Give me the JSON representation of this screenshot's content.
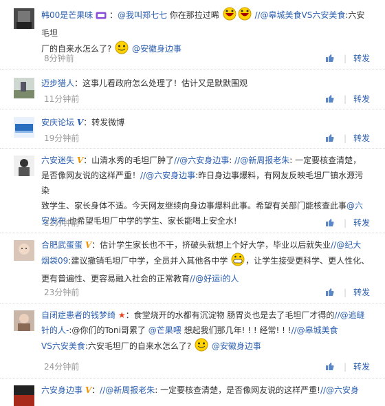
{
  "actions": {
    "reply_label": "转发"
  },
  "colors": {
    "link": "#2a5eb0",
    "time": "#999999",
    "vip_orange": "#f29400",
    "vip_blue": "#2a5eb0"
  },
  "comments": [
    {
      "name": "韩00是芒果味",
      "parts": [
        "：",
        "@我叫郑七七",
        " 你在那拉过晞",
        "//@皋城美食VS六安美食",
        ":六安毛坦",
        "厂的自来水怎么了?",
        "@安徽身边事"
      ],
      "time": "8分钟前"
    },
    {
      "name": "迈步猎人",
      "text": "：这事儿看政府怎么处理了！估计又是默默围观",
      "time": "11分钟前"
    },
    {
      "name": "安庆论坛",
      "text": "：转发微博",
      "time": "19分钟前"
    },
    {
      "name": "六安迷失",
      "line1": [
        "：山清水秀的毛坦厂肿了",
        "//@六安身边事",
        ": ",
        "//@新周报老朱",
        ": 一定要核查清楚，"
      ],
      "line2": "是否像网友说的这样严重！",
      "line2_link": "//@六安身边事",
      "line2_rest": ":昨日身边事爆料，有网友反映毛坦厂镇水源污染",
      "line3": "致学生、家长身体不适。今天网友继续向身边事爆料此事。希望有关部门能核查此事",
      "line3_link": "@六",
      "line4_link": "安发布",
      "line4_rest": " 也希望毛坦厂中学的学生、家长能喝上安全水!",
      "time": "21分钟前"
    },
    {
      "name": "合肥武蛋蛋",
      "line1": "：估计学生家长也不干，挤破头就想上个好大学，毕业以后就失业",
      "line1_link": "//@纪大",
      "line2_link": "烟袋09",
      "line2_rest": ":建议撤销毛坦厂中学，全员并入其他各中学",
      "line2_tail": "，让学生接受更科学、更人性化、",
      "line3_rest": "更有普遍性、更容易融入社会的正常教育",
      "line3_link": "//@好运i的人",
      "time": "23分钟前"
    },
    {
      "name": "自闭症患者的钱梦绮",
      "line1": "：食堂烧开的水都有沉淀物 肠胃炎也是去了毛坦厂才得的",
      "line1_link": "//@追缝",
      "line2_link": "针的人-",
      "line2_mid": ":@你们的Toni哥累了",
      "line2_link2": " @芒果喂",
      "line2_rest": " 想起我们那几年! ! ! 经常! ! !",
      "line2_link3": "//@皋城美食",
      "line3_link": "VS六安美食",
      "line3_rest": ":六安毛坦厂的自来水怎么了?",
      "line3_link2": "@安徽身边事",
      "time": "24分钟前"
    },
    {
      "name": "六安身边事",
      "line1": "：",
      "line1_link": "//@新周报老朱",
      "line1_rest": ": 一定要核查清楚，是否像网友说的这样严重!",
      "line1_link2": "//@六安身"
    }
  ]
}
